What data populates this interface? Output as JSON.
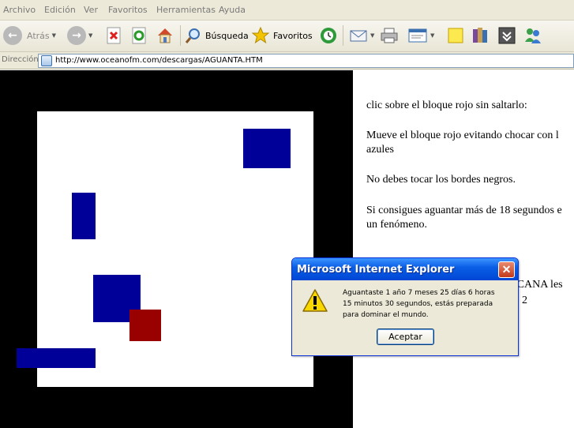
{
  "menu": [
    "Archivo",
    "Edición",
    "Ver",
    "Favoritos",
    "Herramientas",
    "Ayuda"
  ],
  "toolbar": {
    "back_label": "Atrás",
    "search_label": "Búsqueda",
    "favorites_label": "Favoritos"
  },
  "address": {
    "label": "Dirección",
    "url": "http://www.oceanofm.com/descargas/AGUANTA.HTM"
  },
  "page": {
    "instructions": [
      "clic sobre el bloque rojo sin saltarlo:",
      "Mueve el bloque rojo evitando chocar con l",
      "azules",
      "No debes tocar los bordes negros.",
      "Si consigues aguantar más de 18 segundos e",
      "un fenómeno.",
      "ICANA les",
      "s 2"
    ]
  },
  "dialog": {
    "title": "Microsoft Internet Explorer",
    "message": "Aguantaste 1 año 7 meses 25 días 6 horas\n15 minutos 30 segundos, estás preparada\npara dominar el mundo.",
    "ok_label": "Aceptar"
  },
  "colors": {
    "blue_block": "#000099",
    "red_block": "#990000",
    "border": "#000000"
  }
}
